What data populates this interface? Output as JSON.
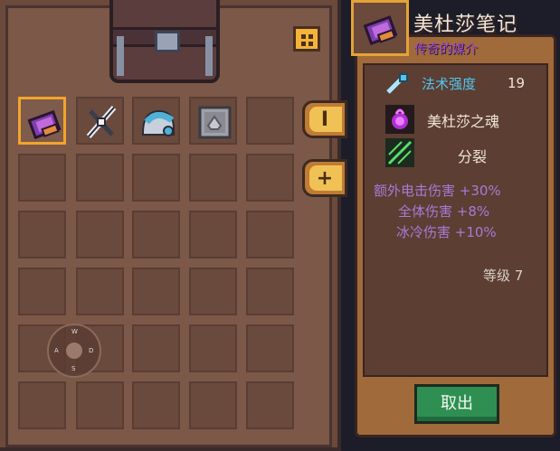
{
  "item_detail": {
    "name": "美杜莎笔记",
    "rarity": "传奇的媒介",
    "stat_label": "法术强度",
    "stat_value": "19",
    "ability_1": "美杜莎之魂",
    "ability_2": "分裂",
    "bonus_1": "额外电击伤害 +30%",
    "bonus_2": "全体伤害 +8%",
    "bonus_3": "冰冷伤害 +10%",
    "level": "等级 7",
    "take_button": "取出"
  },
  "side_tabs": {
    "tab_1": "I",
    "tab_2": "+"
  },
  "joystick": {
    "n": "W",
    "w": "A",
    "e": "D",
    "s": "S"
  },
  "colors": {
    "rarity": "#9c4ad6",
    "stat": "#53c5ee",
    "bonus": "#a67bd6",
    "selected_border": "#f3a42b",
    "take_button": "#2f8f52"
  },
  "inventory": {
    "items": [
      "medusa-notes-icon",
      "crossbow-icon",
      "helmet-icon",
      "shield-icon"
    ]
  }
}
